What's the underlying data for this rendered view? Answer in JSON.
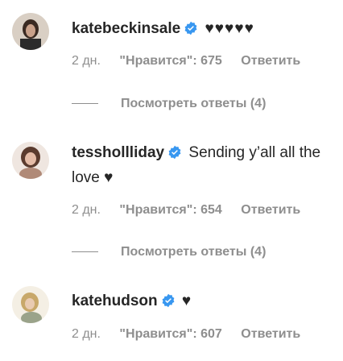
{
  "comments": [
    {
      "username": "katebeckinsale",
      "text": "♥♥♥♥♥",
      "time": "2 дн.",
      "likes": "\"Нравится\": 675",
      "reply": "Ответить",
      "view_replies": "Посмотреть ответы (4)"
    },
    {
      "username": "tesshollliday",
      "text": "Sending y’all all the love ♥",
      "time": "2 дн.",
      "likes": "\"Нравится\": 654",
      "reply": "Ответить",
      "view_replies": "Посмотреть ответы (4)"
    },
    {
      "username": "katehudson",
      "text": "♥",
      "time": "2 дн.",
      "likes": "\"Нравится\": 607",
      "reply": "Ответить"
    }
  ],
  "colors": {
    "verified_badge": "#3897f0",
    "text_primary": "#262626",
    "text_secondary": "#8e8e8e"
  },
  "icons": {
    "verified": "verified-badge-icon",
    "heart": "heart-icon"
  }
}
